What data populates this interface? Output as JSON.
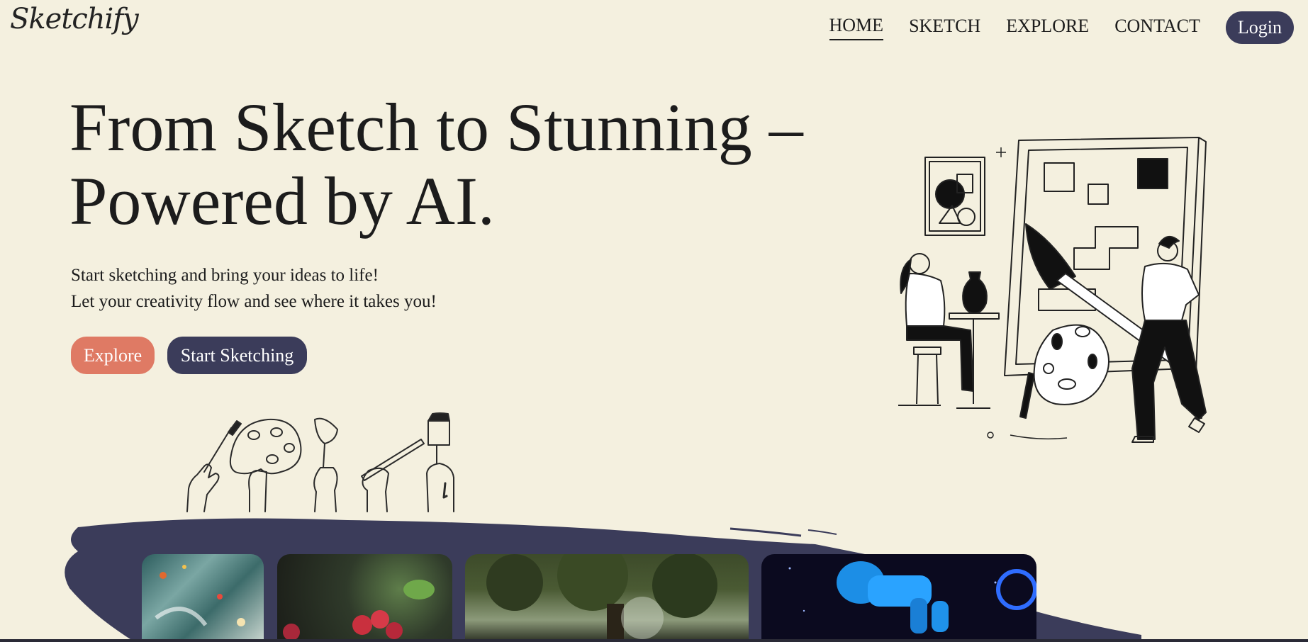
{
  "brand": {
    "logo_text": "Sketchify"
  },
  "nav": {
    "items": [
      {
        "label": "HOME",
        "active": true
      },
      {
        "label": "SKETCH",
        "active": false
      },
      {
        "label": "EXPLORE",
        "active": false
      },
      {
        "label": "CONTACT",
        "active": false
      }
    ],
    "login_label": "Login"
  },
  "hero": {
    "title": "From Sketch to Stunning – Powered by AI.",
    "subtitle_line1": "Start sketching and bring your ideas to life!",
    "subtitle_line2": "Let your creativity flow and see where it takes you!",
    "explore_label": "Explore",
    "start_label": "Start Sketching"
  },
  "colors": {
    "background": "#f4f0df",
    "accent": "#df7a64",
    "primary": "#3b3c5a"
  },
  "gallery": {
    "cards": [
      {
        "name": "abstract-paint-card"
      },
      {
        "name": "raspberries-card"
      },
      {
        "name": "forest-card"
      },
      {
        "name": "astronaut-card"
      }
    ]
  }
}
